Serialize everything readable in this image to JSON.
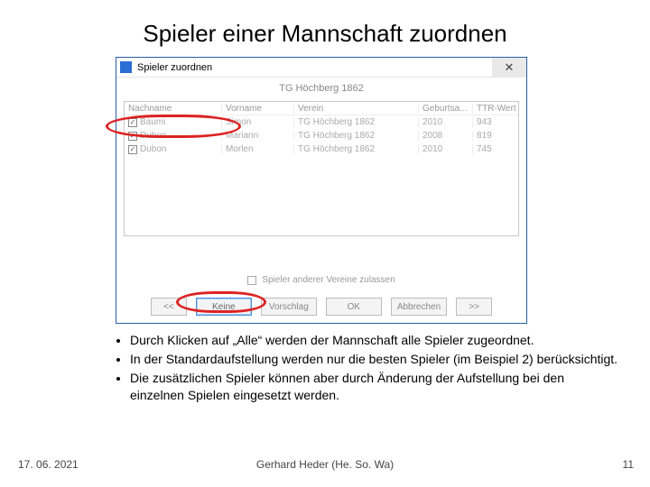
{
  "title": "Spieler einer Mannschaft zuordnen",
  "window": {
    "title": "Spieler zuordnen",
    "close_icon": "✕",
    "subtitle": "TG Höchberg 1862",
    "columns": [
      "Nachname",
      "Vorname",
      "Verein",
      "Geburtsa...",
      "TTR-Wert"
    ],
    "rows": [
      {
        "nachname": "Baumi",
        "vorname": "Simon",
        "verein": "TG Höchberg 1862",
        "geburt": "2010",
        "ttr": "943"
      },
      {
        "nachname": "Dubon",
        "vorname": "Mariann",
        "verein": "TG Höchberg 1862",
        "geburt": "2008",
        "ttr": "819"
      },
      {
        "nachname": "Dubon",
        "vorname": "Morlen",
        "verein": "TG Höchberg 1862",
        "geburt": "2010",
        "ttr": "745"
      }
    ],
    "allow_other": "Spieler anderer Vereine zulassen",
    "buttons": {
      "prev": "<<",
      "keine": "Keine",
      "vorschlag": "Vorschlag",
      "ok": "OK",
      "abbrechen": "Abbrechen",
      "next": ">>"
    }
  },
  "bullets": [
    "Durch Klicken auf „Alle“ werden der Mannschaft alle Spieler zugeordnet.",
    "In der Standardaufstellung werden nur die besten Spieler (im Beispiel 2) berücksichtigt.",
    "Die zusätzlichen Spieler können aber durch Änderung der Aufstellung bei den einzelnen Spielen eingesetzt werden."
  ],
  "footer": {
    "date": "17. 06. 2021",
    "center": "Gerhard Heder (He. So. Wa)",
    "page": "11"
  }
}
